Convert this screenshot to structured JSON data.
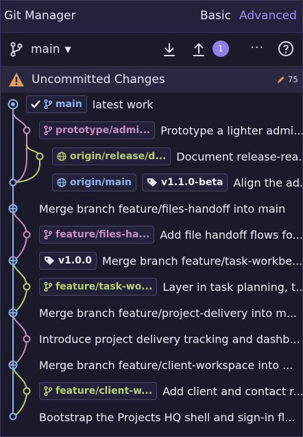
{
  "app": {
    "title": "Git Manager",
    "mode_basic": "Basic",
    "mode_advanced": "Advanced"
  },
  "toolbar": {
    "branch": "main",
    "badge_count": "1"
  },
  "uncommitted": {
    "label": "Uncommitted Changes",
    "count": "75"
  },
  "colors": {
    "accent": "#9d8cf5",
    "lane_main": "#8fb4e8",
    "lane_pink": "#c48fbc",
    "lane_green": "#b7cf6e",
    "badge": "#8f7fe8"
  },
  "commits": [
    {
      "tags": [
        {
          "label": "main",
          "icon": "branch-icon",
          "color": "blue",
          "checked": true
        }
      ],
      "message": "latest work"
    },
    {
      "tags": [
        {
          "label": "prototype/admi...",
          "icon": "branch-icon",
          "color": "pink"
        }
      ],
      "message": "Prototype a lighter admi..."
    },
    {
      "tags": [
        {
          "label": "origin/release/d...",
          "icon": "globe-icon",
          "color": "green"
        }
      ],
      "message": "Document release-rea..."
    },
    {
      "tags": [
        {
          "label": "origin/main",
          "icon": "globe-icon",
          "color": "blue"
        },
        {
          "label": "v1.1.0-beta",
          "icon": "tag-icon",
          "color": "white"
        }
      ],
      "message": "Align the ad..."
    },
    {
      "tags": [],
      "message": "Merge branch feature/files-handoff into main"
    },
    {
      "tags": [
        {
          "label": "feature/files-ha...",
          "icon": "branch-icon",
          "color": "pink"
        }
      ],
      "message": "Add file handoff flows fo..."
    },
    {
      "tags": [
        {
          "label": "v1.0.0",
          "icon": "tag-icon",
          "color": "white"
        }
      ],
      "message": "Merge branch feature/task-workbe..."
    },
    {
      "tags": [
        {
          "label": "feature/task-wo...",
          "icon": "branch-icon",
          "color": "green"
        }
      ],
      "message": "Layer in task planning, t..."
    },
    {
      "tags": [],
      "message": "Merge branch feature/project-delivery into m..."
    },
    {
      "tags": [],
      "message": "Introduce project delivery tracking and dashb..."
    },
    {
      "tags": [],
      "message": "Merge branch feature/client-workspace into ..."
    },
    {
      "tags": [
        {
          "label": "feature/client-w...",
          "icon": "branch-icon",
          "color": "green"
        }
      ],
      "message": "Add client and contact r..."
    },
    {
      "tags": [],
      "message": "Bootstrap the Projects HQ shell and sign-in fl..."
    }
  ]
}
